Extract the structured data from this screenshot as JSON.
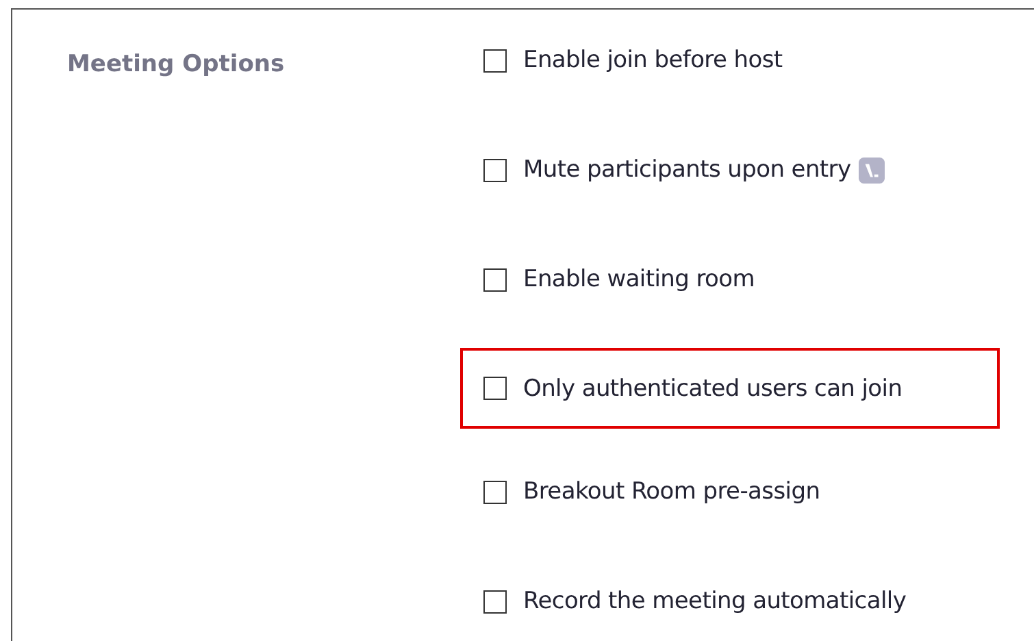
{
  "section": {
    "label": "Meeting Options"
  },
  "options": [
    {
      "label": "Enable join before host",
      "checked": false,
      "highlighted": false,
      "has_icon": false
    },
    {
      "label": "Mute participants upon entry",
      "checked": false,
      "highlighted": false,
      "has_icon": true
    },
    {
      "label": "Enable waiting room",
      "checked": false,
      "highlighted": false,
      "has_icon": false
    },
    {
      "label": "Only authenticated users can join",
      "checked": false,
      "highlighted": true,
      "has_icon": false
    },
    {
      "label": "Breakout Room pre-assign",
      "checked": false,
      "highlighted": false,
      "has_icon": false
    },
    {
      "label": "Record the meeting automatically",
      "checked": false,
      "highlighted": false,
      "has_icon": false
    }
  ]
}
